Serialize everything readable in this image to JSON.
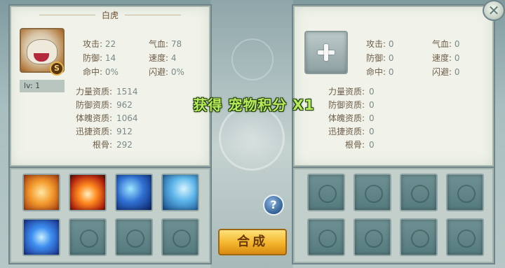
{
  "left_pet": {
    "title": "白虎",
    "rank_badge": "S",
    "level": "lv: 1",
    "stats": [
      {
        "label": "攻击:",
        "value": "22"
      },
      {
        "label": "气血:",
        "value": "78"
      },
      {
        "label": "防御:",
        "value": "14"
      },
      {
        "label": "速度:",
        "value": "4"
      },
      {
        "label": "命中:",
        "value": "0%"
      },
      {
        "label": "闪避:",
        "value": "0%"
      }
    ],
    "aptitudes": [
      {
        "label": "力量资质:",
        "value": "1514"
      },
      {
        "label": "防御资质:",
        "value": "962"
      },
      {
        "label": "体魄资质:",
        "value": "1064"
      },
      {
        "label": "迅捷资质:",
        "value": "912"
      },
      {
        "label": "根骨:",
        "value": "292"
      }
    ]
  },
  "right_pet": {
    "stats": [
      {
        "label": "攻击:",
        "value": "0"
      },
      {
        "label": "气血:",
        "value": "0"
      },
      {
        "label": "防御:",
        "value": "0"
      },
      {
        "label": "速度:",
        "value": "0"
      },
      {
        "label": "命中:",
        "value": "0"
      },
      {
        "label": "闪避:",
        "value": "0"
      }
    ],
    "aptitudes": [
      {
        "label": "力量资质:",
        "value": "0"
      },
      {
        "label": "防御资质:",
        "value": "0"
      },
      {
        "label": "体魄资质:",
        "value": "0"
      },
      {
        "label": "迅捷资质:",
        "value": "0"
      },
      {
        "label": "根骨:",
        "value": "0"
      }
    ]
  },
  "left_skills": [
    "fire-beast-icon",
    "phoenix-icon",
    "moon-strike-icon",
    "lightning-icon",
    "spirit-orb-icon",
    "empty",
    "empty",
    "empty"
  ],
  "right_skills": [
    "empty",
    "empty",
    "empty",
    "empty",
    "empty",
    "empty",
    "empty",
    "empty"
  ],
  "banner": "获得 宠物积分 X1",
  "buttons": {
    "help": "?",
    "compose": "合成",
    "close": "✕"
  },
  "colors": {
    "banner_text": "#b9ec5a",
    "compose_button": "#f3b52b",
    "panel_background": "#f1f3ea"
  }
}
